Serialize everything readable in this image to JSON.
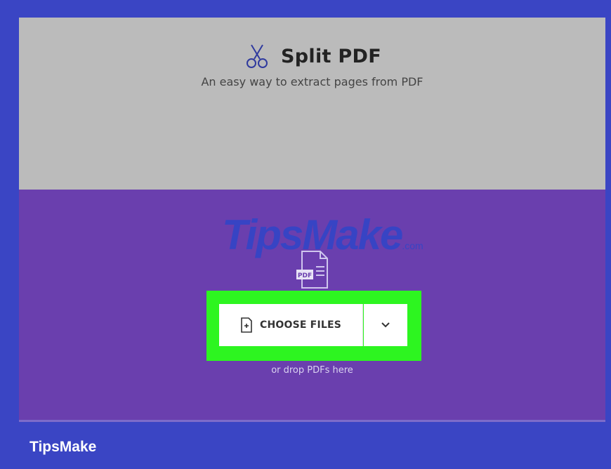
{
  "header": {
    "title": "Split PDF",
    "subtitle": "An easy way to extract pages from PDF",
    "title_icon": "scissors-icon"
  },
  "upload": {
    "watermark_text": "TipsMake",
    "watermark_suffix": ".com",
    "pdf_badge": "PDF",
    "choose_files_label": "CHOOSE FILES",
    "choose_icon": "file-plus-icon",
    "dropdown_icon": "chevron-down-icon",
    "drop_hint": "or drop PDFs here"
  },
  "footer": {
    "brand": "TipsMake"
  },
  "colors": {
    "frame": "#3a45c4",
    "header_bg": "#bbbbbb",
    "upload_bg": "#6a3fae",
    "highlight": "#2df520",
    "button_bg": "#ffffff"
  }
}
